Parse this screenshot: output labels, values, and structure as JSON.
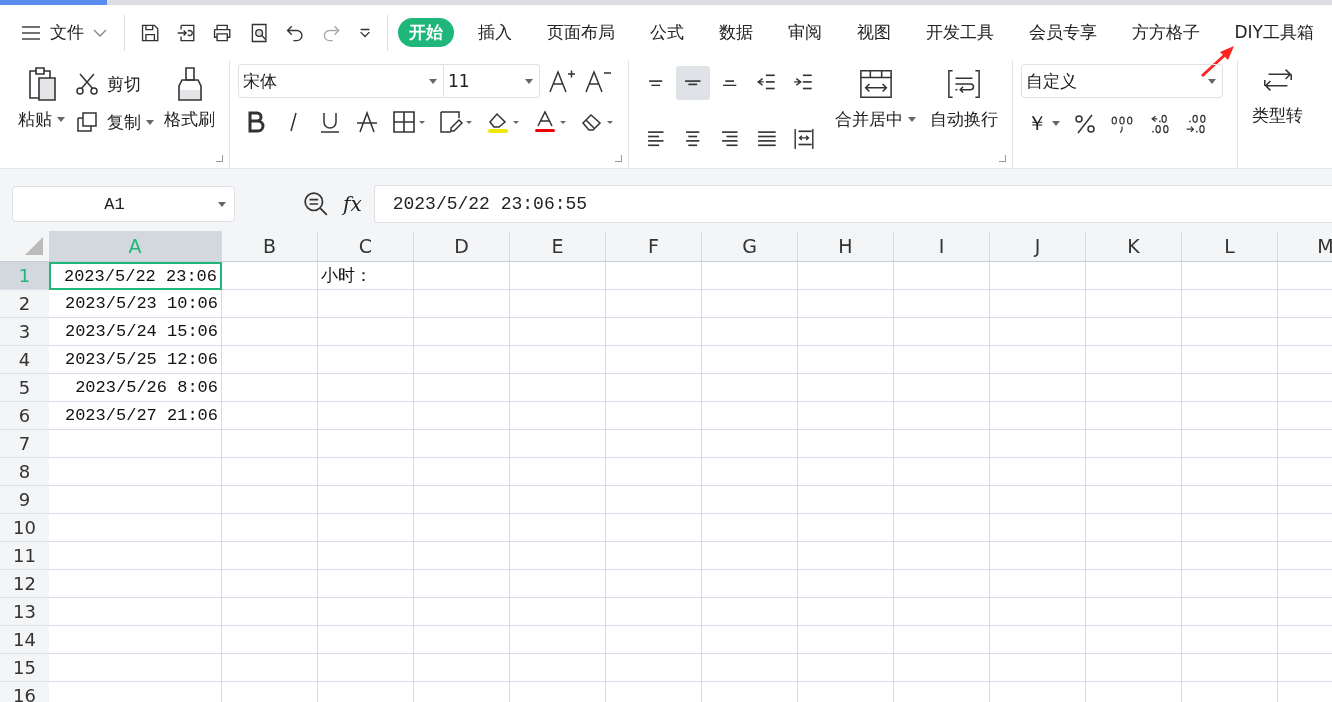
{
  "file_menu": {
    "label": "文件"
  },
  "tabs": [
    {
      "label": "开始",
      "selected": true
    },
    {
      "label": "插入",
      "selected": false
    },
    {
      "label": "页面布局",
      "selected": false
    },
    {
      "label": "公式",
      "selected": false
    },
    {
      "label": "数据",
      "selected": false
    },
    {
      "label": "审阅",
      "selected": false
    },
    {
      "label": "视图",
      "selected": false
    },
    {
      "label": "开发工具",
      "selected": false
    },
    {
      "label": "会员专享",
      "selected": false
    },
    {
      "label": "方方格子",
      "selected": false
    },
    {
      "label": "DIY工具箱",
      "selected": false
    }
  ],
  "clipboard": {
    "paste": "粘贴",
    "cut": "剪切",
    "copy": "复制",
    "format_painter": "格式刷"
  },
  "font": {
    "name": "宋体",
    "size": "11"
  },
  "alignment": {
    "buttons": [
      {
        "kind": "top",
        "selected": false
      },
      {
        "kind": "middle",
        "selected": true
      },
      {
        "kind": "bottom",
        "selected": false
      },
      {
        "kind": "outdent",
        "selected": false
      },
      {
        "kind": "indent",
        "selected": false
      },
      {
        "kind": "left",
        "selected": false
      },
      {
        "kind": "center",
        "selected": false
      },
      {
        "kind": "right",
        "selected": false
      },
      {
        "kind": "justify",
        "selected": false
      },
      {
        "kind": "distributed",
        "selected": false
      }
    ],
    "merge": "合并居中",
    "wrap": "自动换行"
  },
  "number": {
    "format": "自定义",
    "currency": "￥",
    "convert": "类型转"
  },
  "name_box": "A1",
  "function_label": "fx",
  "formula": "2023/5/22 23:06:55",
  "columns": [
    {
      "label": "A",
      "selected": true
    },
    {
      "label": "B",
      "selected": false
    },
    {
      "label": "C",
      "selected": false
    },
    {
      "label": "D",
      "selected": false
    },
    {
      "label": "E",
      "selected": false
    },
    {
      "label": "F",
      "selected": false
    },
    {
      "label": "G",
      "selected": false
    },
    {
      "label": "H",
      "selected": false
    },
    {
      "label": "I",
      "selected": false
    },
    {
      "label": "J",
      "selected": false
    },
    {
      "label": "K",
      "selected": false
    },
    {
      "label": "L",
      "selected": false
    },
    {
      "label": "M",
      "selected": false
    }
  ],
  "rows": [
    {
      "label": "1",
      "selected": true,
      "a": "2023/5/22 23:06",
      "c": "小时："
    },
    {
      "label": "2",
      "selected": false,
      "a": "2023/5/23 10:06"
    },
    {
      "label": "3",
      "selected": false,
      "a": "2023/5/24 15:06"
    },
    {
      "label": "4",
      "selected": false,
      "a": "2023/5/25 12:06"
    },
    {
      "label": "5",
      "selected": false,
      "a": "2023/5/26 8:06"
    },
    {
      "label": "6",
      "selected": false,
      "a": "2023/5/27 21:06"
    },
    {
      "label": "7",
      "selected": false
    },
    {
      "label": "8",
      "selected": false
    },
    {
      "label": "9",
      "selected": false
    },
    {
      "label": "10",
      "selected": false
    },
    {
      "label": "11",
      "selected": false
    },
    {
      "label": "12",
      "selected": false
    },
    {
      "label": "13",
      "selected": false
    },
    {
      "label": "14",
      "selected": false
    },
    {
      "label": "15",
      "selected": false
    },
    {
      "label": "16",
      "selected": false
    }
  ]
}
